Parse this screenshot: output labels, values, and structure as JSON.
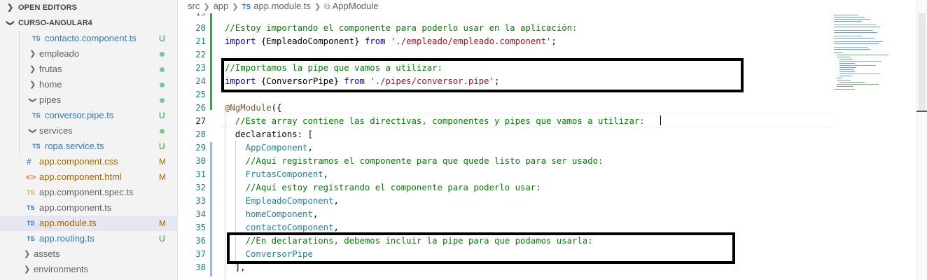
{
  "sidebar": {
    "open_editors": "OPEN EDITORS",
    "project": "CURSO-ANGULAR4",
    "items": [
      {
        "name": "contacto.component.ts",
        "icon": "TS",
        "badge": "U"
      },
      {
        "name": "empleado",
        "icon": "folder",
        "badge": "dot"
      },
      {
        "name": "frutas",
        "icon": "folder",
        "badge": "dot"
      },
      {
        "name": "home",
        "icon": "folder",
        "badge": "dot"
      },
      {
        "name": "pipes",
        "icon": "folder",
        "badge": "dot"
      },
      {
        "name": "conversor.pipe.ts",
        "icon": "TS",
        "badge": "U"
      },
      {
        "name": "services",
        "icon": "folder",
        "badge": "dot"
      },
      {
        "name": "ropa.service.ts",
        "icon": "TS",
        "badge": "U"
      },
      {
        "name": "app.component.css",
        "icon": "#",
        "badge": "M"
      },
      {
        "name": "app.component.html",
        "icon": "<>",
        "badge": "M"
      },
      {
        "name": "app.component.spec.ts",
        "icon": "TS",
        "badge": ""
      },
      {
        "name": "app.component.ts",
        "icon": "TS",
        "badge": ""
      },
      {
        "name": "app.module.ts",
        "icon": "TS",
        "badge": "M"
      },
      {
        "name": "app.routing.ts",
        "icon": "TS",
        "badge": "U"
      },
      {
        "name": "assets",
        "icon": "folder",
        "badge": ""
      },
      {
        "name": "environments",
        "icon": "folder",
        "badge": ""
      }
    ]
  },
  "breadcrumb": {
    "src": "src",
    "app": "app",
    "ts_icon": "TS",
    "file": "app.module.ts",
    "symbol": "AppModule"
  },
  "editor": {
    "lines": [
      {
        "num": "19",
        "text": ""
      },
      {
        "num": "20",
        "text": "//Estoy importando el componente para poderlo usar en la aplicación:"
      },
      {
        "num": "21",
        "kw": "import",
        "mid": " {EmpleadoComponent} ",
        "kw2": "from",
        "str": " './empleado/empleado.component'",
        "end": ";"
      },
      {
        "num": "22",
        "text": ""
      },
      {
        "num": "23",
        "text": "//Importamos la pipe que vamos a utilizar:"
      },
      {
        "num": "24",
        "kw": "import",
        "mid": " {ConversorPipe} ",
        "kw2": "from",
        "str": " './pipes/conversor.pipe'",
        "end": ";"
      },
      {
        "num": "25",
        "text": ""
      },
      {
        "num": "26",
        "dec": "@NgModule",
        "rest": "({"
      },
      {
        "num": "27",
        "text": "  //Este array contiene las directivas, componentes y pipes que vamos a utilizar:"
      },
      {
        "num": "28",
        "text": "  declarations: ["
      },
      {
        "num": "29",
        "id": "    AppComponent",
        "rest": ","
      },
      {
        "num": "30",
        "text": "    //Aquí registramos el componente para que quede listo para ser usado:"
      },
      {
        "num": "31",
        "id": "    FrutasComponent",
        "rest": ","
      },
      {
        "num": "32",
        "text": "    //Aquí estoy registrando el componente para poderlo usar:"
      },
      {
        "num": "33",
        "id": "    EmpleadoComponent",
        "rest": ","
      },
      {
        "num": "34",
        "id": "    homeComponent",
        "rest": ","
      },
      {
        "num": "35",
        "id": "    contactoComponent",
        "rest": ","
      },
      {
        "num": "36",
        "text": "    //En declarations, debemos incluir la pipe para que podamos usarla:"
      },
      {
        "num": "37",
        "id": "    ConversorPipe",
        "rest": ""
      },
      {
        "num": "38",
        "text": "  ],"
      }
    ]
  },
  "colors": {
    "comment": "#008000",
    "keyword": "#0000ff",
    "string": "#a31515",
    "type": "#267f99",
    "line_number": "#237893",
    "added": "#48985d",
    "modified": "#9bb9e6"
  }
}
